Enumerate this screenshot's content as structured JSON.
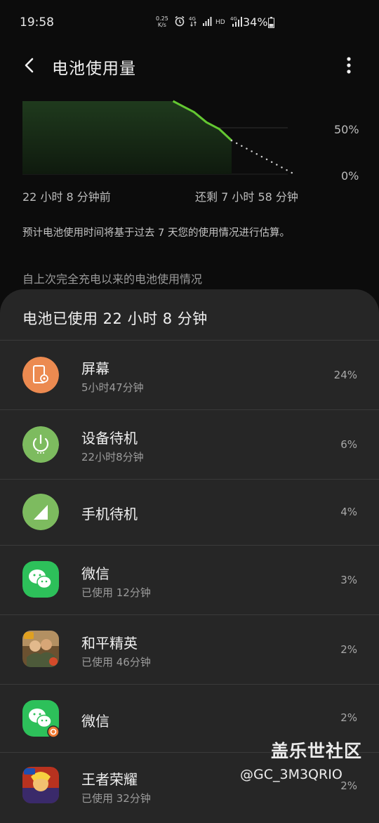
{
  "status_bar": {
    "time": "19:58",
    "net_speed_value": "0.25",
    "net_speed_unit": "K/s",
    "battery_percent": "34%",
    "icons": [
      "alarm-icon",
      "4g-data-icon",
      "signal-icon",
      "hd-icon",
      "4g-signal-icon",
      "battery-icon"
    ]
  },
  "header": {
    "title": "电池使用量"
  },
  "chart_data": {
    "type": "area",
    "start_label": "22 小时 8 分钟前",
    "end_label": "还剩 7 小时 58 分钟",
    "y_ticks": [
      "50%",
      "0%"
    ],
    "ylim": [
      0,
      100
    ],
    "actual": [
      {
        "t": 0.0,
        "level": 100
      },
      {
        "t": 0.72,
        "level": 100
      },
      {
        "t": 0.82,
        "level": 85
      },
      {
        "t": 0.88,
        "level": 71
      },
      {
        "t": 0.94,
        "level": 62
      },
      {
        "t": 1.0,
        "level": 46
      }
    ],
    "predicted": [
      {
        "t": 1.0,
        "level": 46
      },
      {
        "t": 1.3,
        "level": 0
      }
    ],
    "accent_color": "#64c832"
  },
  "note": "预计电池使用时间将基于过去 7 天您的使用情况进行估算。",
  "section_title": "自上次完全充电以来的电池使用情况",
  "sheet": {
    "title": "电池已使用 22 小时 8 分钟",
    "items": [
      {
        "name": "屏幕",
        "sub": "5小时47分钟",
        "pct": "24%",
        "icon": "screen-icon",
        "color": "#ec8a50"
      },
      {
        "name": "设备待机",
        "sub": "22小时8分钟",
        "pct": "6%",
        "icon": "power-icon",
        "color": "#7dbb5f"
      },
      {
        "name": "手机待机",
        "sub": "",
        "pct": "4%",
        "icon": "signal-icon",
        "color": "#7dbb5f"
      },
      {
        "name": "微信",
        "sub": "已使用 12分钟",
        "pct": "3%",
        "icon": "wechat-icon",
        "color": "#2dc05a"
      },
      {
        "name": "和平精英",
        "sub": "已使用 46分钟",
        "pct": "2%",
        "icon": "game-peace-elite-icon",
        "color": "#8a6a3a"
      },
      {
        "name": "微信",
        "sub": "",
        "pct": "2%",
        "icon": "wechat-clone-icon",
        "color": "#2dc05a"
      },
      {
        "name": "王者荣耀",
        "sub": "已使用 32分钟",
        "pct": "2%",
        "icon": "game-honor-of-kings-icon",
        "color": "#c83a2a"
      }
    ]
  },
  "watermark": {
    "brand": "盖乐世社区",
    "user": "@GC_3M3QRIO"
  }
}
